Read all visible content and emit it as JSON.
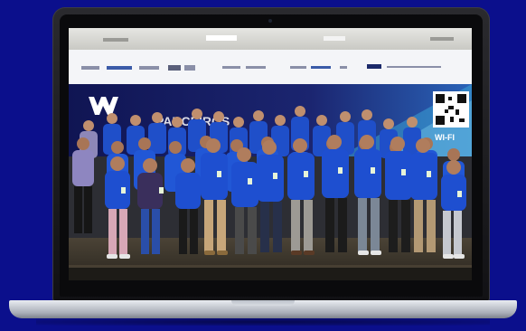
{
  "photo": {
    "description_icon": "group-photo-icon",
    "banner_brand": "W",
    "wifi_label": "WI-FI"
  },
  "colors": {
    "background": "#0b0f8c",
    "shirt_blue": "#1f4fc9",
    "banner_navy": "#151b5a"
  }
}
